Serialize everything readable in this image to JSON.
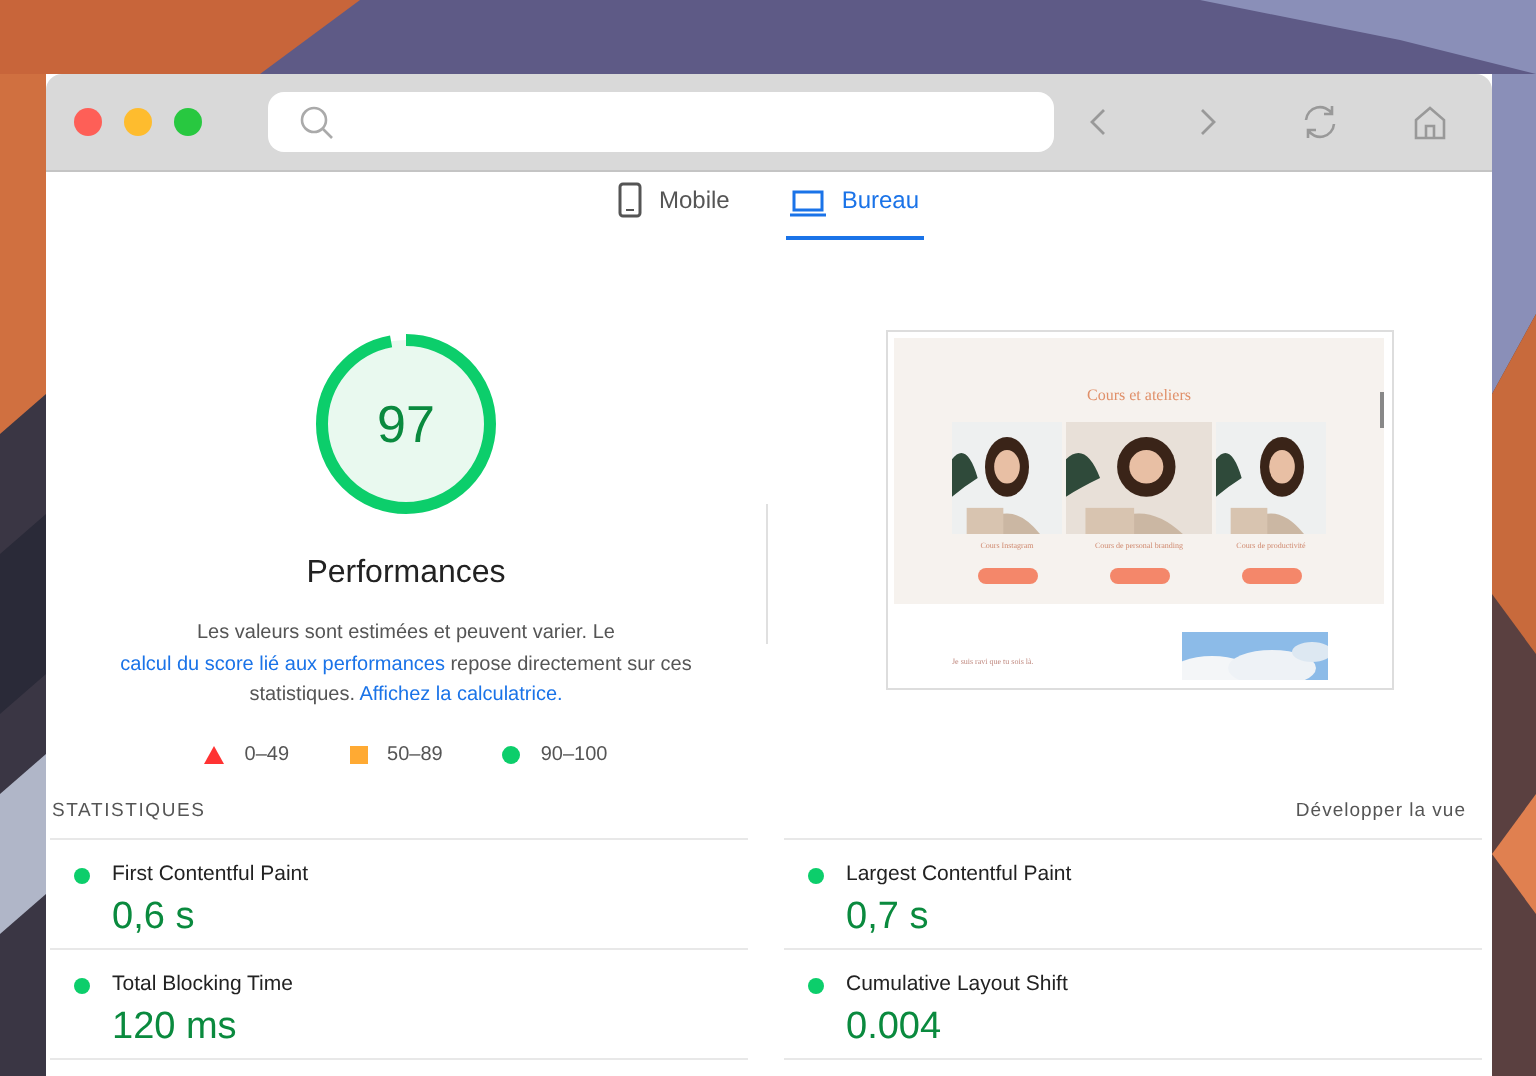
{
  "tabs": [
    {
      "label": "Mobile",
      "kind": "phone",
      "selected": false
    },
    {
      "label": "Bureau",
      "kind": "laptop",
      "selected": true
    }
  ],
  "score": {
    "value": "97",
    "level": 0.97,
    "label": "Performances"
  },
  "description": "Les valeurs sont estimées et peuvent varier. Le ",
  "links": [
    "calcul du score lié aux performances",
    "Affichez la calculatrice."
  ],
  "description_middle": " repose directement sur ces statistiques. ",
  "legend": [
    {
      "kind": "triangle",
      "color": "#ff3333",
      "label": "0–49"
    },
    {
      "kind": "square",
      "color": "#ffaa33",
      "label": "50–89"
    },
    {
      "kind": "circle",
      "color": "#0cce6b",
      "label": "90–100"
    }
  ],
  "preview": {
    "heading": "Cours et ateliers",
    "cards": [
      "Cours Instagram",
      "Cours de personal branding",
      "Cours de productivité"
    ],
    "footer_text": "Je suis ravi que tu sois là."
  },
  "statistics": {
    "title": "STATISTIQUES",
    "expand": "Développer la vue",
    "metrics": [
      {
        "name": "First Contentful Paint",
        "value": "0,6 s"
      },
      {
        "name": "Largest Contentful Paint",
        "value": "0,7 s"
      },
      {
        "name": "Total Blocking Time",
        "value": "120 ms"
      },
      {
        "name": "Cumulative Layout Shift",
        "value": "0.004"
      }
    ]
  }
}
